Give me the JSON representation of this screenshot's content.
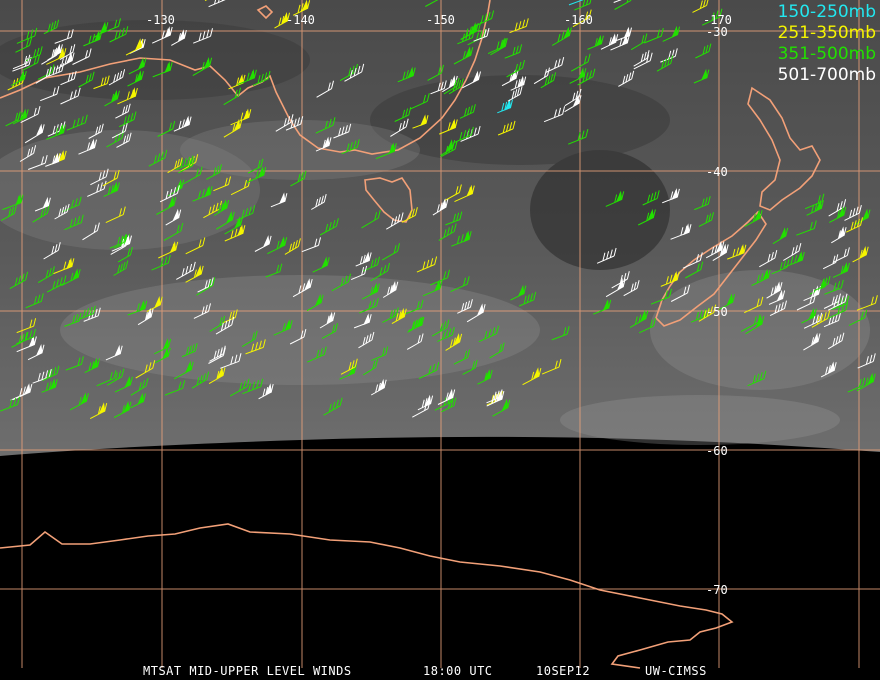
{
  "legend": [
    {
      "label": "150-250mb",
      "color": "#22e8f0"
    },
    {
      "label": "251-350mb",
      "color": "#f5f500"
    },
    {
      "label": "351-500mb",
      "color": "#22e000"
    },
    {
      "label": "501-700mb",
      "color": "#ffffff"
    }
  ],
  "longitude_labels": [
    "-130",
    "-140",
    "-150",
    "-160",
    "-170"
  ],
  "latitude_labels": [
    "-30",
    "-40",
    "-50",
    "-60",
    "-70"
  ],
  "footer": {
    "product": "MTSAT MID-UPPER LEVEL WINDS",
    "time": "18:00 UTC",
    "date": "10SEP12",
    "source": "UW-CIMSS"
  },
  "colors": {
    "coastline": "#f2a078",
    "gridline": "#e8a07a",
    "background": "#000000"
  }
}
